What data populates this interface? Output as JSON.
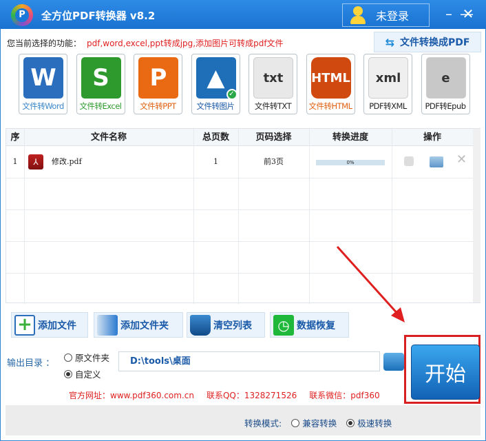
{
  "app": {
    "title": "全方位PDF转换器 v8.2",
    "login": "未登录",
    "logo_letter": "P"
  },
  "function": {
    "label": "您当前选择的功能：",
    "value": "pdf,word,excel,ppt转成jpg,添加图片可转成pdf文件",
    "to_pdf_button": "文件转换成PDF"
  },
  "tools": [
    {
      "label": "文件转Word",
      "icon": "W",
      "color": "#2a6ebd",
      "text_color": "#3a86c8"
    },
    {
      "label": "文件转Excel",
      "icon": "S",
      "color": "#2e9a2e",
      "text_color": "#2e9a2e"
    },
    {
      "label": "文件转PPT",
      "icon": "P",
      "color": "#ea6a14",
      "text_color": "#e06010"
    },
    {
      "label": "文件转图片",
      "icon": "▲",
      "color": "#1f6fb8",
      "text_color": "#1a5aa8",
      "selected": true
    },
    {
      "label": "文件转TXT",
      "icon": "txt",
      "color": "#e8e8e8",
      "text_color": "#222"
    },
    {
      "label": "文件转HTML",
      "icon": "HTML",
      "color": "#d04a10",
      "text_color": "#e06010"
    },
    {
      "label": "PDF转XML",
      "icon": "xml",
      "color": "#efefef",
      "text_color": "#222"
    },
    {
      "label": "PDF转Epub",
      "icon": "e",
      "color": "#c8c8c8",
      "text_color": "#222"
    }
  ],
  "table": {
    "headers": [
      "序",
      "文件名称",
      "总页数",
      "页码选择",
      "转换进度",
      "操作"
    ],
    "rows": [
      {
        "index": "1",
        "name": "修改.pdf",
        "pages": "1",
        "page_select": "前3页",
        "progress": "0%"
      }
    ]
  },
  "buttons": {
    "add_file": "添加文件",
    "add_folder": "添加文件夹",
    "clear_list": "清空列表",
    "restore": "数据恢复",
    "start": "开始"
  },
  "output": {
    "label": "输出目录 ：",
    "option_original": "原文件夹",
    "option_custom": "自定义",
    "selected": "自定义",
    "path": "D:\\tools\\桌面"
  },
  "footer": {
    "website": "官方网址：www.pdf360.com.cn",
    "qq": "联系QQ：1328271526",
    "wechat": "联系微信：pdf360"
  },
  "mode": {
    "label": "转换模式:",
    "compat": "兼容转换",
    "fast": "极速转换",
    "selected": "极速转换"
  }
}
